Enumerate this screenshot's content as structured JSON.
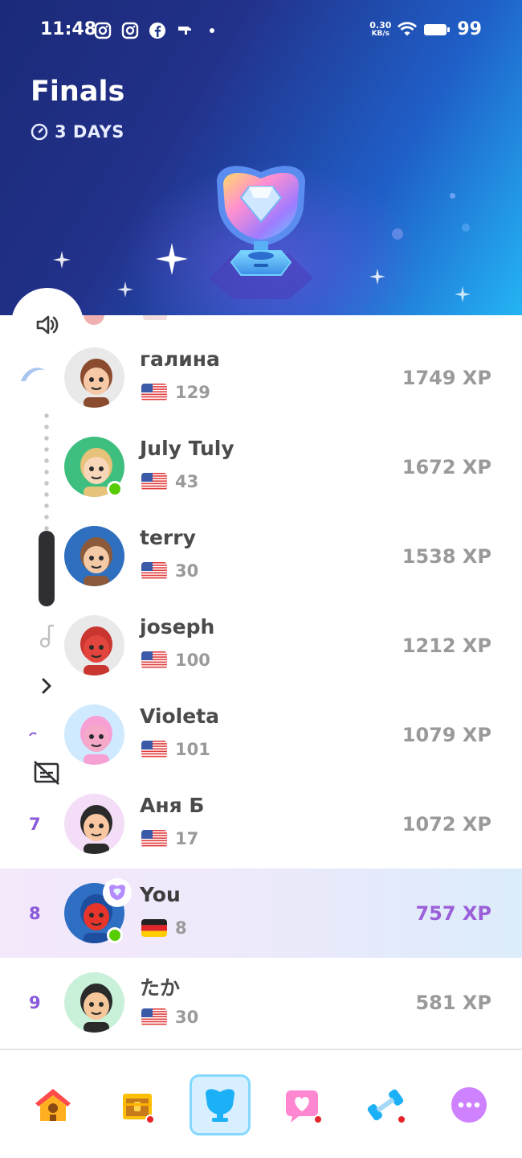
{
  "status_bar": {
    "time": "11:48",
    "net_speed_value": "0.30",
    "net_speed_unit": "KB/s",
    "battery": "99"
  },
  "header": {
    "title": "Finals",
    "timer": "3 DAYS"
  },
  "leaderboard": [
    {
      "rank": "",
      "name": "галина",
      "flag": "us",
      "streak": "129",
      "xp": "1749 XP",
      "online": false
    },
    {
      "rank": "",
      "name": "July Tuly",
      "flag": "us",
      "streak": "43",
      "xp": "1672 XP",
      "online": true
    },
    {
      "rank": "",
      "name": "terry",
      "flag": "us",
      "streak": "30",
      "xp": "1538 XP",
      "online": false
    },
    {
      "rank": "",
      "name": "joseph",
      "flag": "us",
      "streak": "100",
      "xp": "1212 XP",
      "online": false
    },
    {
      "rank": "",
      "name": "Violeta",
      "flag": "us",
      "streak": "101",
      "xp": "1079 XP",
      "online": false
    },
    {
      "rank": "7",
      "name": "Аня Б",
      "flag": "us",
      "streak": "17",
      "xp": "1072 XP",
      "online": false
    },
    {
      "rank": "8",
      "name": "You",
      "flag": "de",
      "streak": "8",
      "xp": "757 XP",
      "online": true,
      "is_me": true
    },
    {
      "rank": "9",
      "name": "たか",
      "flag": "us",
      "streak": "30",
      "xp": "581 XP",
      "online": false
    }
  ],
  "bottom_nav": [
    {
      "id": "home",
      "icon": "house-icon",
      "badge": false
    },
    {
      "id": "chest",
      "icon": "treasure-chest-icon",
      "badge": true
    },
    {
      "id": "leagues",
      "icon": "league-trophy-icon",
      "badge": false,
      "active": true
    },
    {
      "id": "friends",
      "icon": "heart-chat-icon",
      "badge": true
    },
    {
      "id": "practice",
      "icon": "dumbbell-icon",
      "badge": true
    },
    {
      "id": "more",
      "icon": "more-icon",
      "badge": false
    }
  ],
  "colors": {
    "accent_purple": "#9b60d9",
    "online_green": "#58cc02",
    "active_nav_bg": "#d7efff"
  }
}
